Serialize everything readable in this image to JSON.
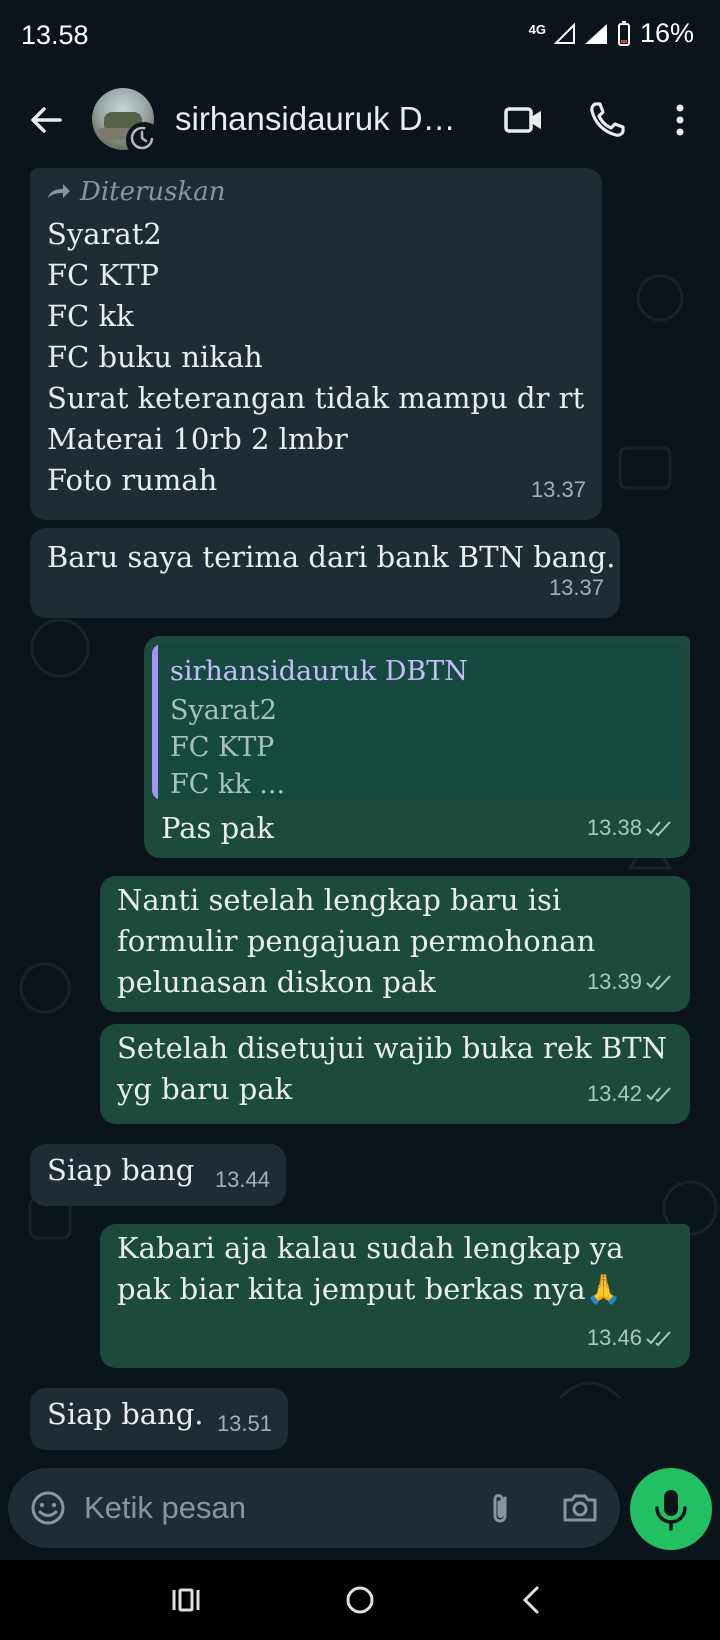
{
  "status_bar": {
    "time": "13.58",
    "network": "4G",
    "battery": "16%"
  },
  "header": {
    "contact_name": "sirhansidauruk DBTN"
  },
  "messages": [
    {
      "direction": "in",
      "forwarded_label": "Diteruskan",
      "lines": [
        "Syarat2",
        "FC KTP",
        "FC kk",
        "FC buku nikah",
        "Surat keterangan tidak mampu dr rt",
        "Materai 10rb 2 lmbr",
        "Foto rumah"
      ],
      "time": "13.37"
    },
    {
      "direction": "in",
      "lines": [
        "Baru saya terima dari bank BTN bang."
      ],
      "time": "13.37"
    },
    {
      "direction": "out",
      "quote": {
        "author": "sirhansidauruk DBTN",
        "lines": [
          "Syarat2",
          "FC KTP",
          "FC kk ..."
        ]
      },
      "lines": [
        "Pas pak"
      ],
      "time": "13.38"
    },
    {
      "direction": "out",
      "lines": [
        "Nanti setelah lengkap baru isi",
        "formulir pengajuan permohonan",
        "pelunasan diskon pak"
      ],
      "time": "13.39"
    },
    {
      "direction": "out",
      "lines": [
        "Setelah disetujui wajib buka rek BTN",
        "yg baru pak"
      ],
      "time": "13.42"
    },
    {
      "direction": "in",
      "lines": [
        "Siap bang"
      ],
      "time": "13.44"
    },
    {
      "direction": "out",
      "lines": [
        "Kabari aja kalau sudah lengkap ya",
        "pak biar kita jemput berkas nya🙏"
      ],
      "time": "13.46"
    },
    {
      "direction": "in",
      "lines": [
        "Siap bang."
      ],
      "time": "13.51"
    }
  ],
  "input": {
    "placeholder": "Ketik pesan"
  },
  "icons": {
    "back": "arrow-left-icon",
    "video": "video-call-icon",
    "call": "phone-icon",
    "menu": "more-vert-icon",
    "emoji": "emoji-icon",
    "attach": "paperclip-icon",
    "camera": "camera-icon",
    "mic": "mic-icon"
  },
  "colors": {
    "background": "#0b141a",
    "incoming": "#202c33",
    "outgoing": "#005c4b",
    "mic": "#21c063",
    "quote_bar": "#a791f8"
  }
}
